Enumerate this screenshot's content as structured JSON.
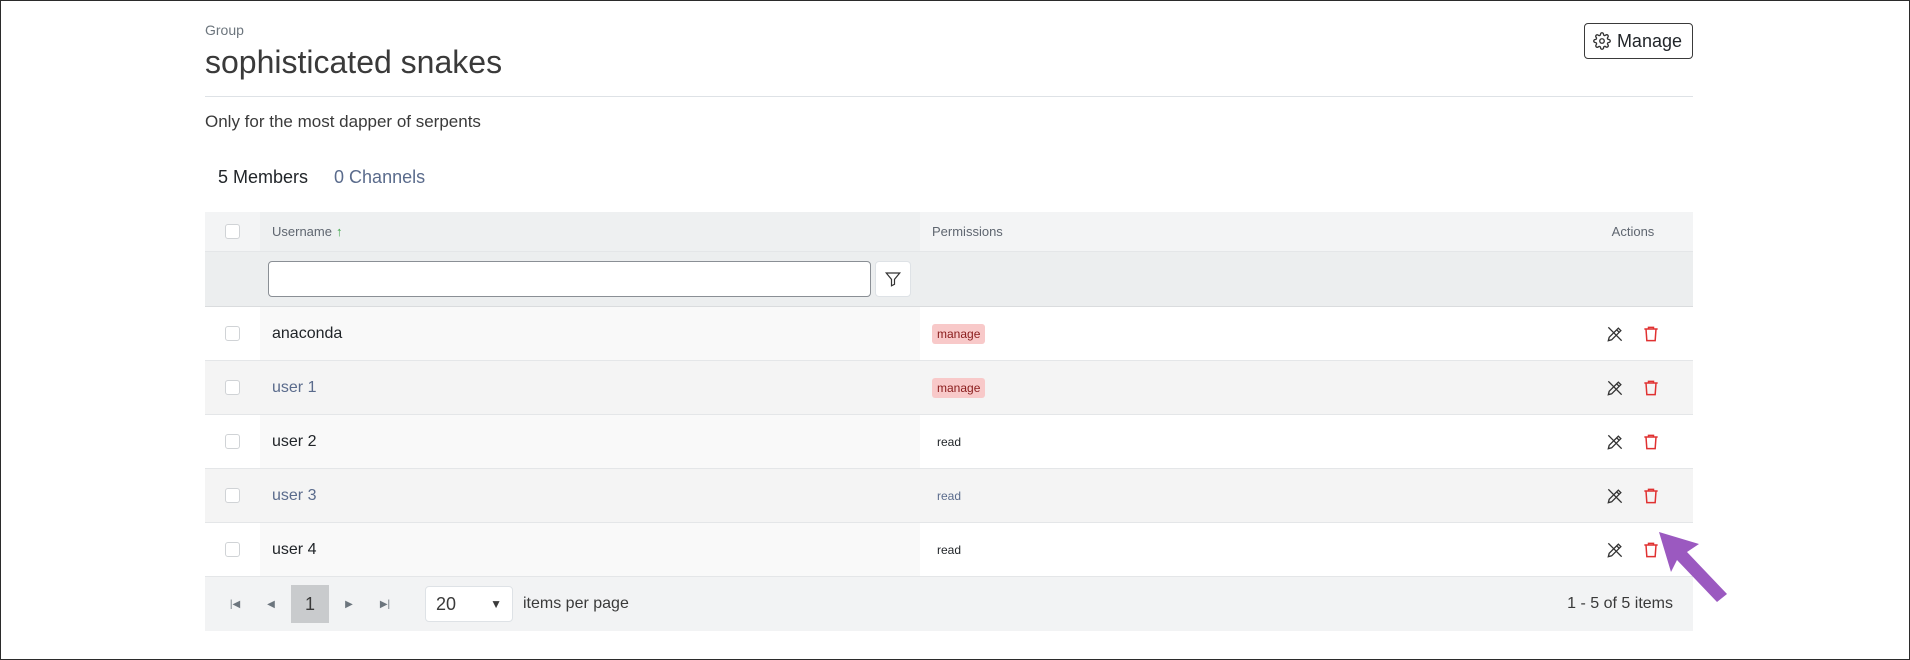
{
  "header": {
    "eyebrow": "Group",
    "title": "sophisticated snakes",
    "manage_label": "Manage",
    "description": "Only for the most dapper of serpents"
  },
  "tabs": [
    {
      "label": "5 Members",
      "active": true
    },
    {
      "label": "0 Channels",
      "active": false
    }
  ],
  "table": {
    "columns": {
      "username": "Username",
      "permissions": "Permissions",
      "actions": "Actions"
    },
    "sort": {
      "column": "username",
      "direction": "ascending",
      "icon": "arrow-up-icon"
    },
    "filter_value": "",
    "rows": [
      {
        "username": "anaconda",
        "permission": "manage"
      },
      {
        "username": "user 1",
        "permission": "manage"
      },
      {
        "username": "user 2",
        "permission": "read"
      },
      {
        "username": "user 3",
        "permission": "read"
      },
      {
        "username": "user 4",
        "permission": "read"
      }
    ]
  },
  "pager": {
    "current_page": "1",
    "page_size": "20",
    "page_size_label": "items per page",
    "info": "1 - 5 of 5 items"
  },
  "colors": {
    "accent": "#3fa64a",
    "manage_badge_bg": "#f8c9c9",
    "delete": "#e03131",
    "pointer": "#9b59c0"
  },
  "icons": {
    "manage": "gear-icon",
    "filter": "filter-icon",
    "edit": "edit-icon",
    "delete": "trash-icon",
    "pointer": "arrow-pointer-icon"
  }
}
